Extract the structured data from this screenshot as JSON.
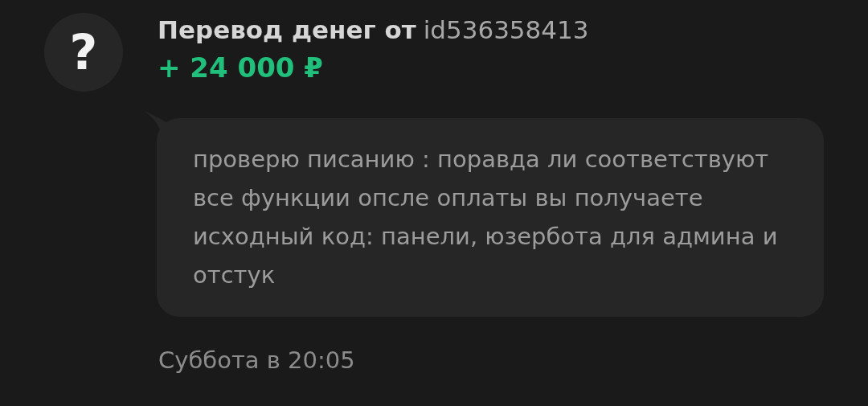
{
  "transfer": {
    "avatar": "?",
    "title": "Перевод денег от",
    "sender": "id536358413",
    "amount": "+ 24 000 ₽"
  },
  "message": {
    "text": "проверю писанию : поравда ли соответствуют все функции опсле оплаты вы получаете исходный код: панели, юзербота для админа и отстук"
  },
  "date": "Суббота в 20:05"
}
